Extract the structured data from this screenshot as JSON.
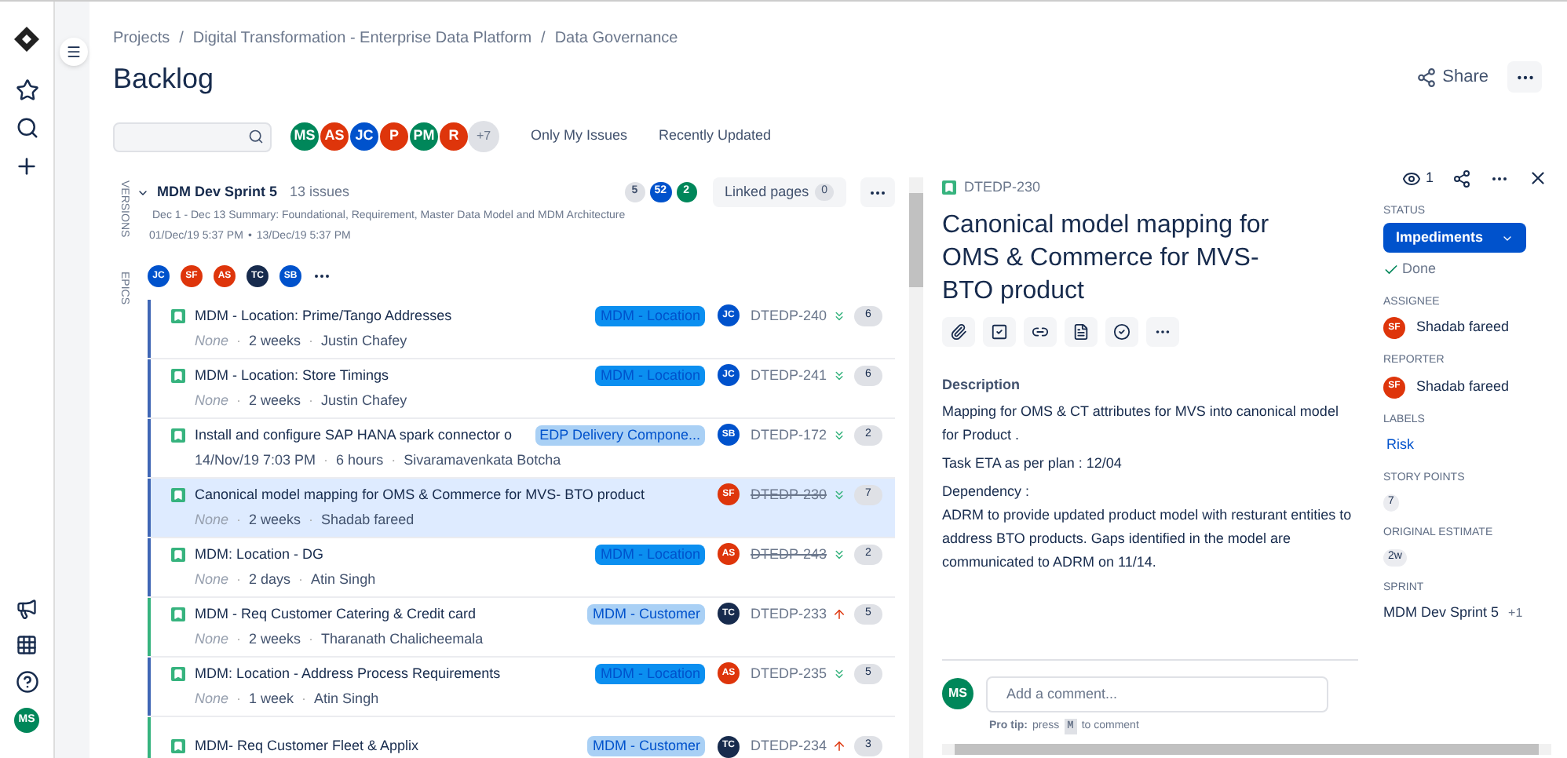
{
  "breadcrumbs": [
    {
      "label": "Projects"
    },
    {
      "separator": "/",
      "label": "Digital Transformation - Enterprise Data Platform"
    },
    {
      "separator": "/",
      "label": "Data Governance"
    }
  ],
  "page_title": "Backlog",
  "header_actions": {
    "share": "Share"
  },
  "filters": {
    "avatars": [
      {
        "initials": "MS",
        "color": "#00875a"
      },
      {
        "initials": "AS",
        "color": "#de350b"
      },
      {
        "initials": "JC",
        "color": "#0052cc"
      },
      {
        "initials": "P",
        "color": "#de350b"
      },
      {
        "initials": "PM",
        "color": "#00875a"
      },
      {
        "initials": "R",
        "color": "#de350b"
      }
    ],
    "more_count": "+7",
    "quick_filters": [
      "Only My Issues",
      "Recently Updated"
    ]
  },
  "side_tabs": [
    "VERSIONS",
    "EPICS"
  ],
  "sprint": {
    "name": "MDM Dev Sprint 5",
    "issue_count": "13 issues",
    "expanded": true,
    "counts": [
      {
        "value": "5",
        "color": "#dfe1e6"
      },
      {
        "value": "52",
        "color": "#0052cc"
      },
      {
        "value": "2",
        "color": "#00875a"
      }
    ],
    "linked_pages": "Linked pages",
    "linked_count": "0",
    "goal": "Dec 1 - Dec 13 Summary: Foundational, Requirement, Master Data Model and MDM Architecture",
    "dates": [
      "01/Dec/19 5:37 PM",
      "•",
      "13/Dec/19 5:37 PM"
    ],
    "assignees": [
      {
        "initials": "JC",
        "color": "#0052cc"
      },
      {
        "initials": "SF",
        "color": "#de350b"
      },
      {
        "initials": "AS",
        "color": "#de350b"
      },
      {
        "initials": "TC",
        "color": "#172b4d"
      },
      {
        "initials": "SB",
        "color": "#0052cc"
      }
    ]
  },
  "issues": [
    {
      "summary": "MDM - Location: Prime/Tango Addresses",
      "meta": [
        "None",
        "·",
        "2 weeks",
        "·",
        "Justin Chafey"
      ],
      "epic": {
        "name": "MDM - Location",
        "color": "#0b8ff0"
      },
      "color": "#3f66b5",
      "assignee": {
        "initials": "JC",
        "color": "#0052cc"
      },
      "key": "DTEDP-240",
      "done": false,
      "priority_high": false,
      "points": "6",
      "selected": false
    },
    {
      "summary": "MDM - Location: Store Timings",
      "meta": [
        "None",
        "·",
        "2 weeks",
        "·",
        "Justin Chafey"
      ],
      "epic": {
        "name": "MDM - Location",
        "color": "#0b8ff0"
      },
      "color": "#3f66b5",
      "assignee": {
        "initials": "JC",
        "color": "#0052cc"
      },
      "key": "DTEDP-241",
      "done": false,
      "priority_high": false,
      "points": "6",
      "selected": false
    },
    {
      "summary": "Install and configure SAP HANA spark connector o",
      "meta": [
        "14/Nov/19 7:03 PM",
        "·",
        "6 hours",
        "·",
        "Sivaramavenkata Botcha"
      ],
      "epic": {
        "name": "EDP Delivery Compone...",
        "color": "#a9d0f5"
      },
      "color": "#3f66b5",
      "assignee": {
        "initials": "SB",
        "color": "#0052cc"
      },
      "key": "DTEDP-172",
      "done": false,
      "priority_high": false,
      "points": "2",
      "selected": false
    },
    {
      "summary": "Canonical model mapping for OMS & Commerce for MVS- BTO product",
      "meta": [
        "None",
        "·",
        "2 weeks",
        "·",
        "Shadab fareed"
      ],
      "color": "#3f66b5",
      "assignee": {
        "initials": "SF",
        "color": "#de350b"
      },
      "key": "DTEDP-230",
      "done": true,
      "priority_high": false,
      "points": "7",
      "selected": true
    },
    {
      "summary": "MDM: Location - DG",
      "meta": [
        "None",
        "·",
        "2 days",
        "·",
        "Atin Singh"
      ],
      "epic": {
        "name": "MDM - Location",
        "color": "#0b8ff0"
      },
      "color": "#3f66b5",
      "assignee": {
        "initials": "AS",
        "color": "#de350b"
      },
      "key": "DTEDP-243",
      "done": true,
      "priority_high": false,
      "points": "2",
      "selected": false
    },
    {
      "summary": "MDM - Req Customer Catering & Credit card",
      "meta": [
        "None",
        "·",
        "2 weeks",
        "·",
        "Tharanath Chalicheemala"
      ],
      "epic": {
        "name": "MDM - Customer",
        "color": "#a9d0f5"
      },
      "color": "#36b37e",
      "assignee": {
        "initials": "TC",
        "color": "#172b4d"
      },
      "key": "DTEDP-233",
      "done": false,
      "priority_high": true,
      "points": "5",
      "selected": false
    },
    {
      "summary": "MDM: Location - Address Process Requirements",
      "meta": [
        "None",
        "·",
        "1 week",
        "·",
        "Atin Singh"
      ],
      "epic": {
        "name": "MDM - Location",
        "color": "#0b8ff0"
      },
      "color": "#3f66b5",
      "assignee": {
        "initials": "AS",
        "color": "#de350b"
      },
      "key": "DTEDP-235",
      "done": false,
      "priority_high": false,
      "points": "5",
      "selected": false
    },
    {
      "summary": "MDM- Req Customer Fleet & Applix",
      "epic": {
        "name": "MDM - Customer",
        "color": "#a9d0f5"
      },
      "color": "#36b37e",
      "assignee": {
        "initials": "TC",
        "color": "#172b4d"
      },
      "key": "DTEDP-234",
      "done": false,
      "priority_high": true,
      "points": "3",
      "selected": false
    }
  ],
  "detail": {
    "key": "DTEDP-230",
    "watchers": "1",
    "title": "Canonical model mapping for OMS & Commerce for MVS- BTO product",
    "description_heading": "Description",
    "description": [
      "Mapping for OMS & CT attributes for MVS into canonical model for Product .",
      "Task ETA as per plan : 12/04",
      "Dependency :\nADRM to provide updated product model with resturant entities to address BTO products. Gaps identified in the model are communicated to ADRM on 11/14."
    ],
    "comment": {
      "avatar": {
        "initials": "MS",
        "color": "#00875a"
      },
      "placeholder": "Add a comment...",
      "tip_label": "Pro tip:",
      "tip_before": "press",
      "tip_key": "M",
      "tip_after": "to comment"
    },
    "fields": [
      {
        "label": "STATUS",
        "kind": "status",
        "value": "Impediments",
        "transition": "Done"
      },
      {
        "label": "ASSIGNEE",
        "kind": "user",
        "value": "Shadab fareed",
        "avatar": {
          "initials": "SF",
          "color": "#de350b"
        }
      },
      {
        "label": "REPORTER",
        "kind": "user",
        "value": "Shadab fareed",
        "avatar": {
          "initials": "SF",
          "color": "#de350b"
        }
      },
      {
        "label": "LABELS",
        "kind": "link",
        "value": "Risk"
      },
      {
        "label": "STORY POINTS",
        "kind": "lozenge",
        "value": "7"
      },
      {
        "label": "ORIGINAL ESTIMATE",
        "kind": "lozenge",
        "value": "2w"
      },
      {
        "label": "SPRINT",
        "kind": "sprint",
        "value": "MDM Dev Sprint 5",
        "extra": "+1"
      }
    ]
  },
  "profile_avatar": {
    "initials": "MS",
    "color": "#00875a"
  }
}
